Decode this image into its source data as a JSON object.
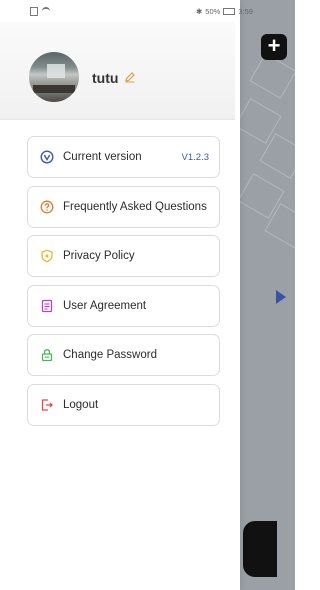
{
  "status_bar": {
    "battery": "50%",
    "time": "3:59"
  },
  "profile": {
    "username": "tutu",
    "edit_icon": "pencil-icon"
  },
  "menu": {
    "items": [
      {
        "label": "Current version",
        "value": "V1.2.3",
        "icon": "version-check-icon",
        "color": "#3b5bb5"
      },
      {
        "label": "Frequently Asked Questions",
        "icon": "question-circle-icon",
        "color": "#e07a2e"
      },
      {
        "label": "Privacy Policy",
        "icon": "shield-icon",
        "color": "#e8b82a"
      },
      {
        "label": "User Agreement",
        "icon": "document-icon",
        "color": "#b246c9"
      },
      {
        "label": "Change Password",
        "icon": "lock-icon",
        "color": "#47b85a"
      },
      {
        "label": "Logout",
        "icon": "logout-icon",
        "color": "#e04a4a"
      }
    ]
  },
  "background_app": {
    "add_icon": "plus-icon",
    "arrow_icon": "chevron-right-icon"
  }
}
